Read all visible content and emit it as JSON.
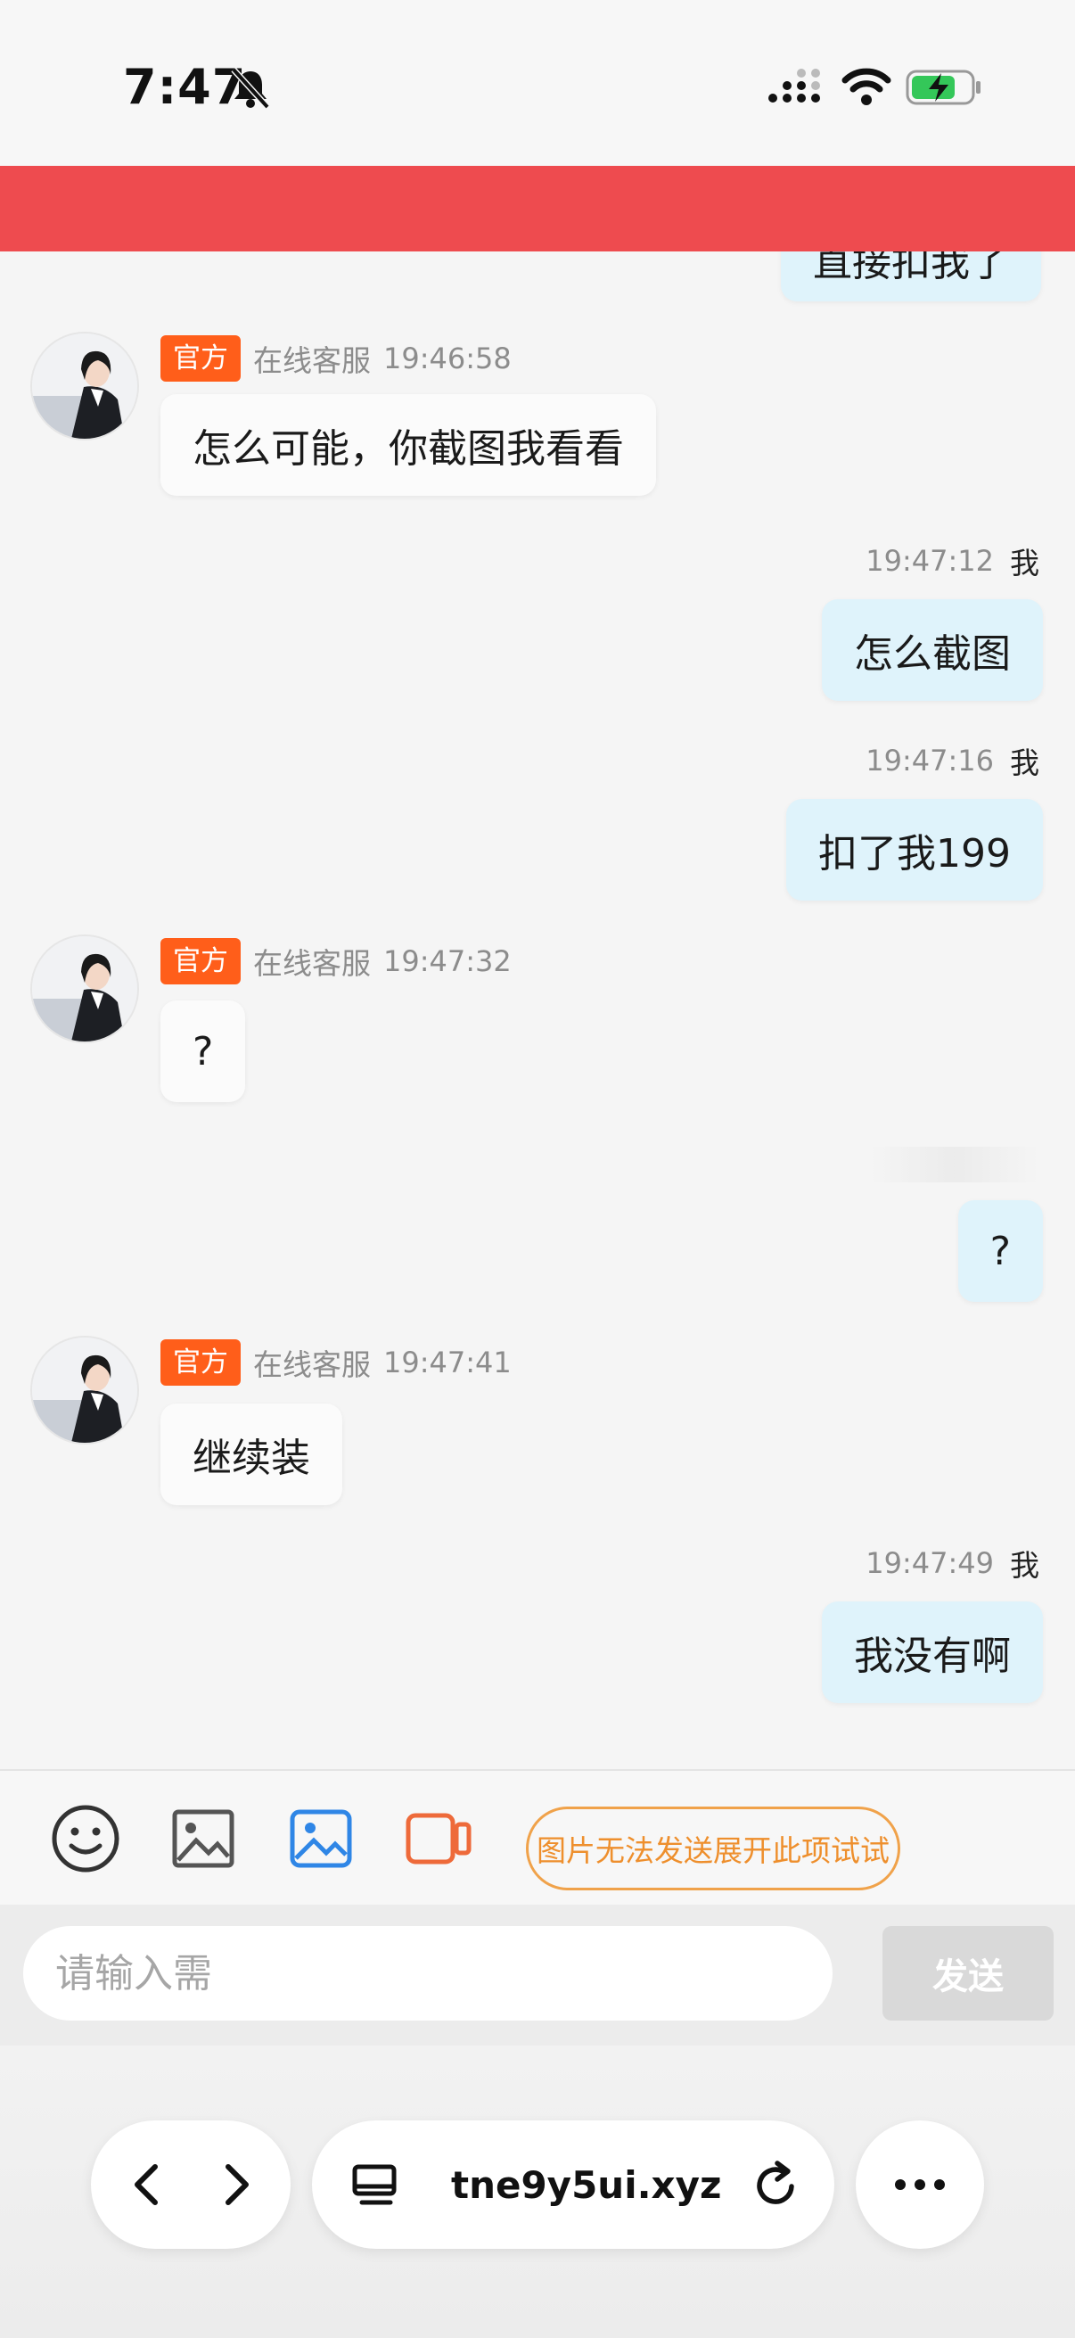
{
  "status_bar": {
    "time": "7:47"
  },
  "chat": {
    "partial_top_text": "直接扣我了",
    "messages": [
      {
        "side": "in",
        "badge": "官方",
        "sender": "在线客服",
        "time": "19:46:58",
        "text": "怎么可能，你截图我看看"
      },
      {
        "side": "out",
        "sender": "我",
        "time": "19:47:12",
        "text": "怎么截图"
      },
      {
        "side": "out",
        "sender": "我",
        "time": "19:47:16",
        "text": "扣了我199"
      },
      {
        "side": "in",
        "badge": "官方",
        "sender": "在线客服",
        "time": "19:47:32",
        "text": "?"
      },
      {
        "side": "out",
        "text": "?"
      },
      {
        "side": "in",
        "badge": "官方",
        "sender": "在线客服",
        "time": "19:47:41",
        "text": "继续装"
      },
      {
        "side": "out",
        "sender": "我",
        "time": "19:47:49",
        "text": "我没有啊"
      }
    ]
  },
  "toolbar": {
    "icons": [
      "emoji-icon",
      "image-icon",
      "photo-icon",
      "video-icon"
    ],
    "hint_button": "图片无法发送展开此项试试",
    "hint_color": "#ee8f2d"
  },
  "input": {
    "placeholder": "请输入需",
    "send_label": "发送"
  },
  "browser": {
    "url": "tne9y5ui.xyz"
  },
  "colors": {
    "banner": "#ee4b4f",
    "badge": "#ff5e1a",
    "outgoing_bubble": "#dff3fb"
  }
}
